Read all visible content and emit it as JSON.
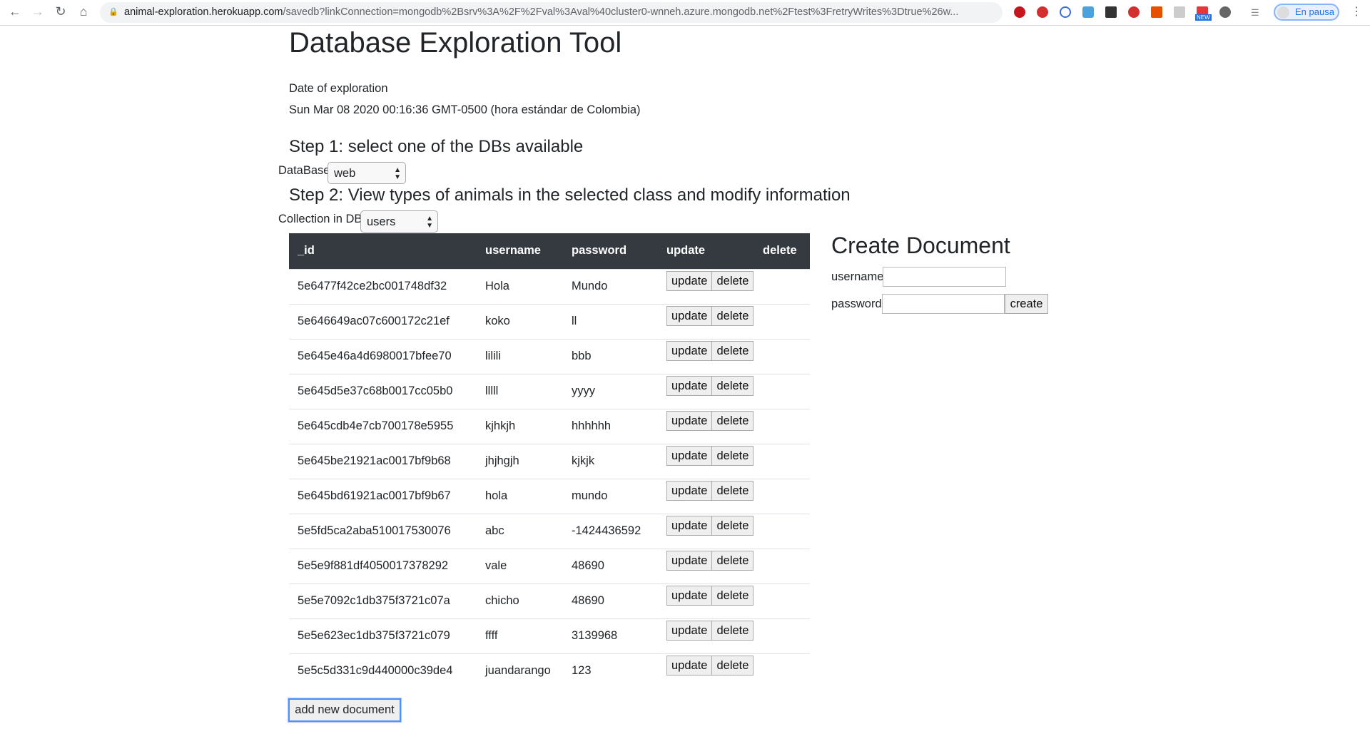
{
  "browser": {
    "url_domain": "animal-exploration.herokuapp.com",
    "url_path": "/savedb?linkConnection=mongodb%2Bsrv%3A%2F%2Fval%3Aval%40cluster0-wnneh.azure.mongodb.net%2Ftest%3FretryWrites%3Dtrue%26w...",
    "profile_label": "En pausa",
    "ext_badge": "NEW"
  },
  "page": {
    "title": "Database Exploration Tool",
    "date_label": "Date of exploration",
    "date_value": "Sun Mar 08 2020 00:16:36 GMT-0500 (hora estándar de Colombia)",
    "step1": "Step 1: select one of the DBs available",
    "db_label": "DataBase",
    "db_selected": "web",
    "step2": "Step 2: View types of animals in the selected class and modify information",
    "collection_label": "Collection in DB",
    "collection_selected": "users",
    "add_button": "add new document"
  },
  "table": {
    "headers": [
      "_id",
      "username",
      "password",
      "update",
      "delete"
    ],
    "update_label": "update",
    "delete_label": "delete",
    "rows": [
      [
        "5e6477f42ce2bc001748df32",
        "Hola",
        "Mundo"
      ],
      [
        "5e646649ac07c600172c21ef",
        "koko",
        "ll"
      ],
      [
        "5e645e46a4d6980017bfee70",
        "lilili",
        "bbb"
      ],
      [
        "5e645d5e37c68b0017cc05b0",
        "lllll",
        "yyyy"
      ],
      [
        "5e645cdb4e7cb700178e5955",
        "kjhkjh",
        "hhhhhh"
      ],
      [
        "5e645be21921ac0017bf9b68",
        "jhjhgjh",
        "kjkjk"
      ],
      [
        "5e645bd61921ac0017bf9b67",
        "hola",
        "mundo"
      ],
      [
        "5e5fd5ca2aba510017530076",
        "abc",
        "-1424436592"
      ],
      [
        "5e5e9f881df4050017378292",
        "vale",
        "48690"
      ],
      [
        "5e5e7092c1db375f3721c07a",
        "chicho",
        "48690"
      ],
      [
        "5e5e623ec1db375f3721c079",
        "ffff",
        "3139968"
      ],
      [
        "5e5c5d331c9d440000c39de4",
        "juandarango",
        "123"
      ]
    ]
  },
  "create": {
    "title": "Create Document",
    "username_label": "username",
    "username_value": "",
    "password_label": "password",
    "password_value": "",
    "create_button": "create"
  }
}
